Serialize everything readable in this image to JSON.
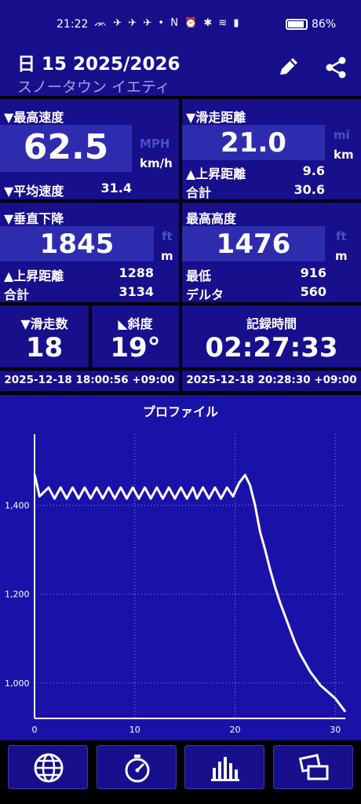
{
  "status": {
    "time": "21:22",
    "icons": "ᨏ ✈ ✈ ✈ •  N ⏰ ✱ ≋ ▮",
    "battery": "86%"
  },
  "header": {
    "title": "日 15 2025/2026",
    "subtitle": "スノータウン イエティ",
    "edit_icon": "pencil-icon",
    "share_icon": "share-icon"
  },
  "speed": {
    "label": "▼最高速度",
    "value": "62.5",
    "unit_alt": "MPH",
    "unit": "km/h",
    "avg_label": "▼平均速度",
    "avg_value": "31.4"
  },
  "run_distance": {
    "label": "▼滑走距離",
    "value": "21.0",
    "unit_alt": "mi",
    "unit": "km",
    "ascent_label": "▲上昇距離",
    "ascent_value": "9.6",
    "total_label": "合計",
    "total_value": "30.6"
  },
  "vertical": {
    "label": "▼垂直下降",
    "value": "1845",
    "unit_alt": "ft",
    "unit": "m",
    "ascent_label": "▲上昇距離",
    "ascent_value": "1288",
    "total_label": "合計",
    "total_value": "3134"
  },
  "altitude": {
    "label": "最高高度",
    "value": "1476",
    "unit_alt": "ft",
    "unit": "m",
    "min_label": "最低",
    "min_value": "916",
    "delta_label": "デルタ",
    "delta_value": "560"
  },
  "runs": {
    "label": "▼滑走数",
    "value": "18"
  },
  "slope": {
    "label": "◣斜度",
    "value": "19°"
  },
  "duration": {
    "label": "記録時間",
    "value": "02:27:33"
  },
  "start_time": "2025-12-18 18:00:56 +09:00",
  "end_time": "2025-12-18 20:28:30 +09:00",
  "colors": {
    "panel": "#170f8c",
    "box": "#2e2cae",
    "chart_bg": "#1a12a8",
    "background": "#000000"
  },
  "chart_data": {
    "type": "line",
    "title": "プロファイル",
    "xlabel": "",
    "ylabel": "",
    "xlim": [
      0,
      31
    ],
    "ylim": [
      920,
      1560
    ],
    "x_ticks": [
      "0",
      "10",
      "20",
      "30"
    ],
    "y_ticks": [
      "1,000",
      "1,200",
      "1,400"
    ],
    "grid": true,
    "series": [
      {
        "x": [
          0,
          0.5,
          1.4,
          2.0,
          2.6,
          3.2,
          3.8,
          4.4,
          5.0,
          5.6,
          6.2,
          6.8,
          7.4,
          8.0,
          8.6,
          9.2,
          9.8,
          10.4,
          11.0,
          11.6,
          12.2,
          12.8,
          13.4,
          14.0,
          14.6,
          15.2,
          15.8,
          16.2,
          16.8,
          17.4,
          18.0,
          18.6,
          19.2,
          19.8,
          20.4,
          21.0,
          21.5,
          22.0,
          22.5,
          23.0,
          23.5,
          24.0,
          24.5,
          25.0,
          25.5,
          26.0,
          26.5,
          27.0,
          27.5,
          28.0,
          28.5,
          29.0,
          29.5,
          30.0,
          30.5,
          31.0
        ],
        "y": [
          1470,
          1420,
          1440,
          1415,
          1440,
          1415,
          1440,
          1415,
          1440,
          1415,
          1440,
          1415,
          1440,
          1415,
          1440,
          1415,
          1440,
          1415,
          1440,
          1415,
          1440,
          1415,
          1440,
          1415,
          1440,
          1415,
          1440,
          1415,
          1440,
          1415,
          1440,
          1415,
          1440,
          1420,
          1450,
          1468,
          1445,
          1400,
          1340,
          1300,
          1255,
          1215,
          1180,
          1150,
          1120,
          1090,
          1065,
          1045,
          1025,
          1010,
          995,
          985,
          975,
          965,
          950,
          935
        ]
      }
    ]
  }
}
